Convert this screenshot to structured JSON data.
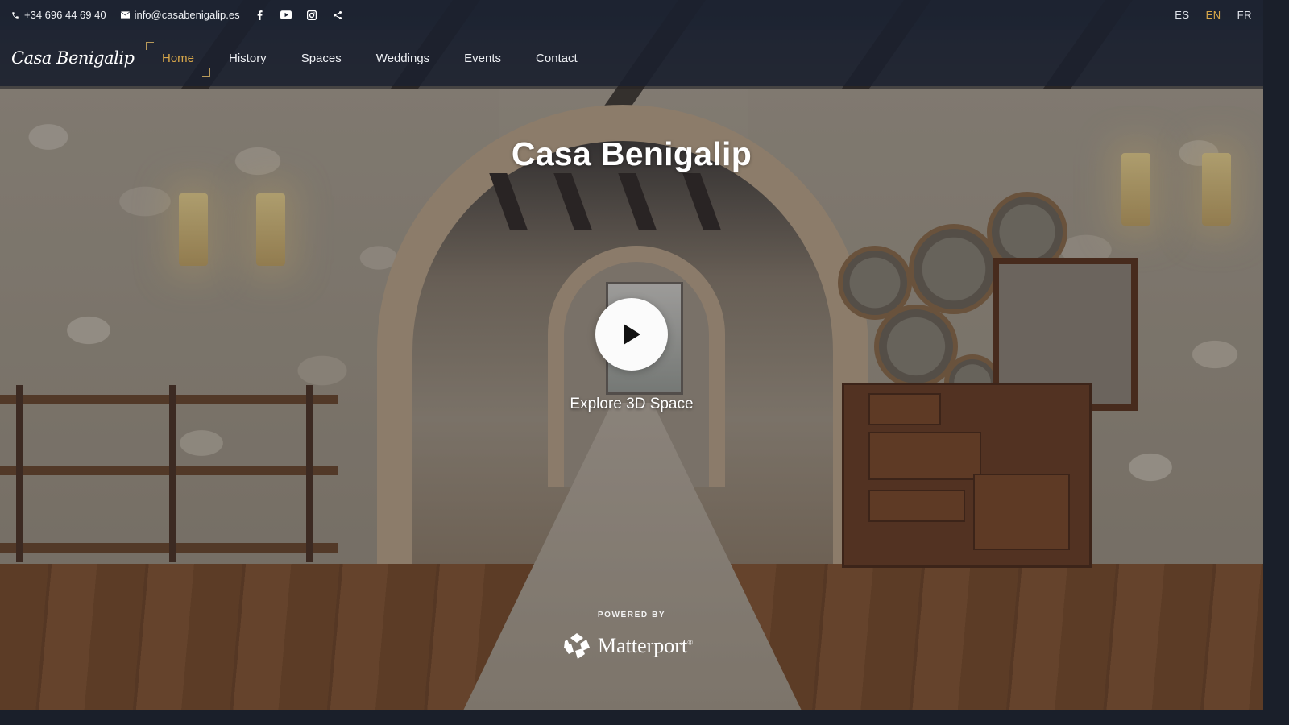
{
  "topbar": {
    "phone": "+34 696 44 69 40",
    "email": "info@casabenigalip.es",
    "social_icons": [
      "facebook-icon",
      "youtube-icon",
      "instagram-icon",
      "share-icon"
    ],
    "languages": [
      {
        "code": "ES",
        "active": false
      },
      {
        "code": "EN",
        "active": true
      },
      {
        "code": "FR",
        "active": false
      }
    ]
  },
  "navbar": {
    "logo": "Casa Benigalip",
    "items": [
      {
        "label": "Home",
        "active": true
      },
      {
        "label": "History",
        "active": false
      },
      {
        "label": "Spaces",
        "active": false
      },
      {
        "label": "Weddings",
        "active": false
      },
      {
        "label": "Events",
        "active": false
      },
      {
        "label": "Contact",
        "active": false
      }
    ]
  },
  "hero": {
    "title": "Casa Benigalip",
    "cta": "Explore 3D Space",
    "powered_by": "POWERED BY",
    "brand": "Matterport"
  },
  "colors": {
    "accent": "#d9a84a",
    "bar_bg": "#1a2130",
    "text": "#ffffff"
  }
}
